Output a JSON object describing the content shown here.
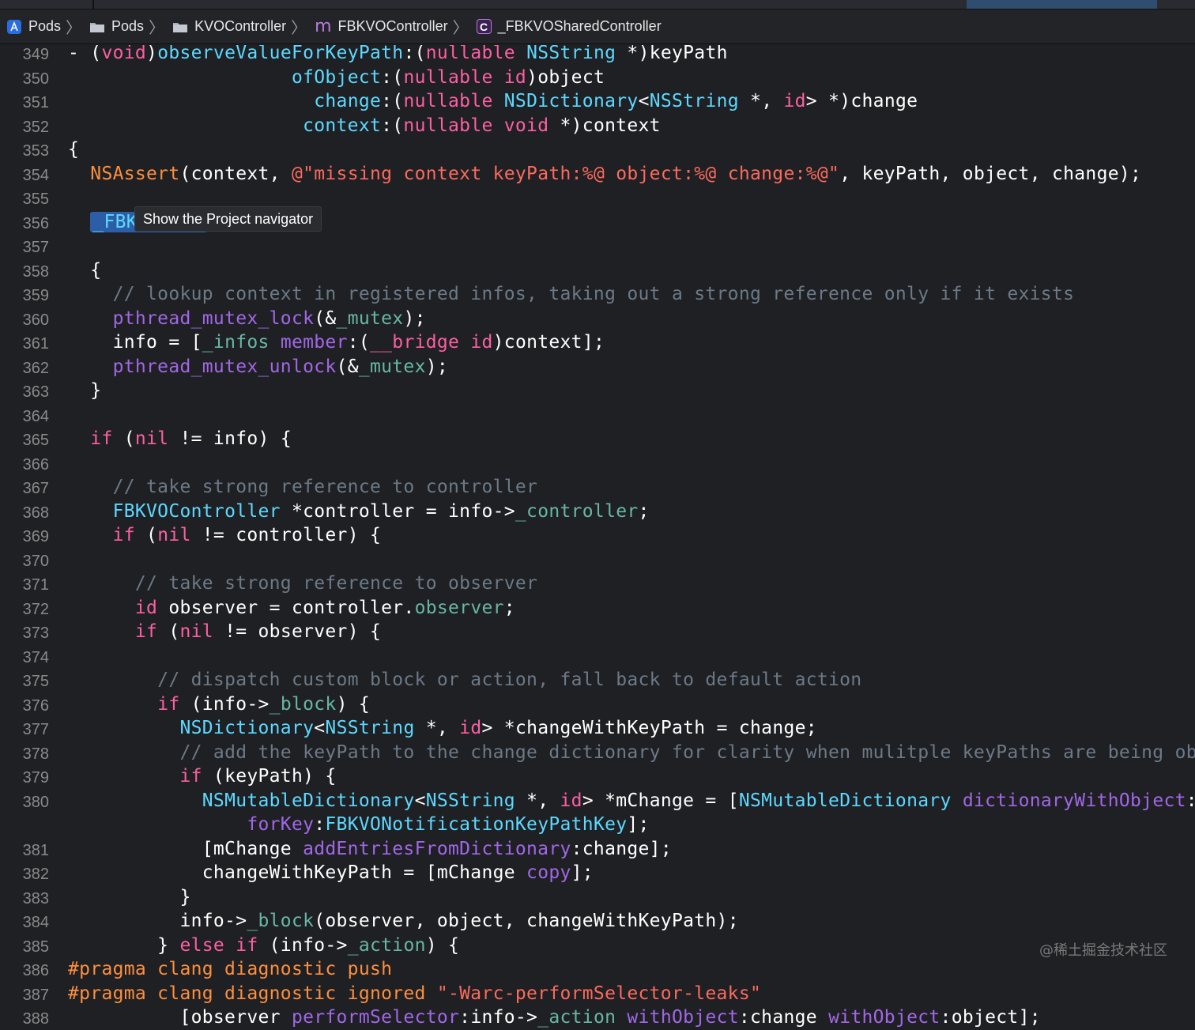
{
  "breadcrumbs": [
    {
      "label": "Pods",
      "icon": "xcode-project-icon"
    },
    {
      "label": "Pods",
      "icon": "folder-icon"
    },
    {
      "label": "KVOController",
      "icon": "folder-icon"
    },
    {
      "label": "FBKVOController",
      "icon": "m-file-icon"
    },
    {
      "label": "_FBKVOSharedController",
      "icon": "class-icon"
    }
  ],
  "tooltip": "Show the Project navigator",
  "watermark": "@稀土掘金技术社区",
  "colors": {
    "keyword": "#fc5fa3",
    "type": "#d0a8ff",
    "class": "#5dd8ff",
    "string": "#fc6a5d",
    "comment": "#6c7986",
    "preprocessor": "#fd8f3f",
    "selection": "#2c5ea8"
  },
  "lines": [
    {
      "n": "349",
      "s": [
        [
          "plain",
          "- ("
        ],
        [
          "kw",
          "void"
        ],
        [
          "plain",
          ")"
        ],
        [
          "cls",
          "observeValueForKeyPath"
        ],
        [
          "plain",
          ":("
        ],
        [
          "kw",
          "nullable"
        ],
        [
          "plain",
          " "
        ],
        [
          "cls",
          "NSString"
        ],
        [
          "plain",
          " *)keyPath"
        ]
      ]
    },
    {
      "n": "350",
      "s": [
        [
          "plain",
          "                    "
        ],
        [
          "cls",
          "ofObject"
        ],
        [
          "plain",
          ":("
        ],
        [
          "kw",
          "nullable"
        ],
        [
          "plain",
          " "
        ],
        [
          "kw",
          "id"
        ],
        [
          "plain",
          ")object"
        ]
      ]
    },
    {
      "n": "351",
      "s": [
        [
          "plain",
          "                      "
        ],
        [
          "cls",
          "change"
        ],
        [
          "plain",
          ":("
        ],
        [
          "kw",
          "nullable"
        ],
        [
          "plain",
          " "
        ],
        [
          "cls",
          "NSDictionary"
        ],
        [
          "plain",
          "<"
        ],
        [
          "cls",
          "NSString"
        ],
        [
          "plain",
          " *, "
        ],
        [
          "kw",
          "id"
        ],
        [
          "plain",
          "> *)change"
        ]
      ]
    },
    {
      "n": "352",
      "s": [
        [
          "plain",
          "                     "
        ],
        [
          "cls",
          "context"
        ],
        [
          "plain",
          ":("
        ],
        [
          "kw",
          "nullable"
        ],
        [
          "plain",
          " "
        ],
        [
          "kw",
          "void"
        ],
        [
          "plain",
          " *)context"
        ]
      ]
    },
    {
      "n": "353",
      "s": [
        [
          "plain",
          "{"
        ]
      ]
    },
    {
      "n": "354",
      "s": [
        [
          "plain",
          "  "
        ],
        [
          "mac",
          "NSAssert"
        ],
        [
          "plain",
          "(context, "
        ],
        [
          "str",
          "@\"missing context keyPath:%@ object:%@ change:%@\""
        ],
        [
          "plain",
          ", keyPath, object, change);"
        ]
      ]
    },
    {
      "n": "355",
      "s": []
    },
    {
      "n": "356",
      "s": [
        [
          "plain",
          "  "
        ],
        [
          "hl",
          "_FBKVOInfo"
        ],
        [
          "plain",
          " *info;"
        ]
      ]
    },
    {
      "n": "357",
      "s": []
    },
    {
      "n": "358",
      "s": [
        [
          "plain",
          "  {"
        ]
      ]
    },
    {
      "n": "359",
      "s": [
        [
          "plain",
          "    "
        ],
        [
          "cm",
          "// lookup context in registered infos, taking out a strong reference only if it exists"
        ]
      ]
    },
    {
      "n": "360",
      "s": [
        [
          "plain",
          "    "
        ],
        [
          "fn",
          "pthread_mutex_lock"
        ],
        [
          "plain",
          "(&"
        ],
        [
          "ivar",
          "_mutex"
        ],
        [
          "plain",
          ");"
        ]
      ]
    },
    {
      "n": "361",
      "s": [
        [
          "plain",
          "    info = ["
        ],
        [
          "ivar",
          "_infos"
        ],
        [
          "plain",
          " "
        ],
        [
          "fn",
          "member"
        ],
        [
          "plain",
          ":("
        ],
        [
          "kw",
          "__bridge"
        ],
        [
          "plain",
          " "
        ],
        [
          "kw",
          "id"
        ],
        [
          "plain",
          ")context];"
        ]
      ]
    },
    {
      "n": "362",
      "s": [
        [
          "plain",
          "    "
        ],
        [
          "fn",
          "pthread_mutex_unlock"
        ],
        [
          "plain",
          "(&"
        ],
        [
          "ivar",
          "_mutex"
        ],
        [
          "plain",
          ");"
        ]
      ]
    },
    {
      "n": "363",
      "s": [
        [
          "plain",
          "  }"
        ]
      ]
    },
    {
      "n": "364",
      "s": []
    },
    {
      "n": "365",
      "s": [
        [
          "plain",
          "  "
        ],
        [
          "kw",
          "if"
        ],
        [
          "plain",
          " ("
        ],
        [
          "kw",
          "nil"
        ],
        [
          "plain",
          " != info) {"
        ]
      ]
    },
    {
      "n": "366",
      "s": []
    },
    {
      "n": "367",
      "s": [
        [
          "plain",
          "    "
        ],
        [
          "cm",
          "// take strong reference to controller"
        ]
      ]
    },
    {
      "n": "368",
      "s": [
        [
          "plain",
          "    "
        ],
        [
          "cls",
          "FBKVOController"
        ],
        [
          "plain",
          " *controller = info->"
        ],
        [
          "ivar",
          "_controller"
        ],
        [
          "plain",
          ";"
        ]
      ]
    },
    {
      "n": "369",
      "s": [
        [
          "plain",
          "    "
        ],
        [
          "kw",
          "if"
        ],
        [
          "plain",
          " ("
        ],
        [
          "kw",
          "nil"
        ],
        [
          "plain",
          " != controller) {"
        ]
      ]
    },
    {
      "n": "370",
      "s": []
    },
    {
      "n": "371",
      "s": [
        [
          "plain",
          "      "
        ],
        [
          "cm",
          "// take strong reference to observer"
        ]
      ]
    },
    {
      "n": "372",
      "s": [
        [
          "plain",
          "      "
        ],
        [
          "kw",
          "id"
        ],
        [
          "plain",
          " observer = controller."
        ],
        [
          "prop",
          "observer"
        ],
        [
          "plain",
          ";"
        ]
      ]
    },
    {
      "n": "373",
      "s": [
        [
          "plain",
          "      "
        ],
        [
          "kw",
          "if"
        ],
        [
          "plain",
          " ("
        ],
        [
          "kw",
          "nil"
        ],
        [
          "plain",
          " != observer) {"
        ]
      ]
    },
    {
      "n": "374",
      "s": []
    },
    {
      "n": "375",
      "s": [
        [
          "plain",
          "        "
        ],
        [
          "cm",
          "// dispatch custom block or action, fall back to default action"
        ]
      ]
    },
    {
      "n": "376",
      "s": [
        [
          "plain",
          "        "
        ],
        [
          "kw",
          "if"
        ],
        [
          "plain",
          " (info->"
        ],
        [
          "ivar",
          "_block"
        ],
        [
          "plain",
          ") {"
        ]
      ]
    },
    {
      "n": "377",
      "s": [
        [
          "plain",
          "          "
        ],
        [
          "cls",
          "NSDictionary"
        ],
        [
          "plain",
          "<"
        ],
        [
          "cls",
          "NSString"
        ],
        [
          "plain",
          " *, "
        ],
        [
          "kw",
          "id"
        ],
        [
          "plain",
          "> *changeWithKeyPath = change;"
        ]
      ]
    },
    {
      "n": "378",
      "s": [
        [
          "plain",
          "          "
        ],
        [
          "cm",
          "// add the keyPath to the change dictionary for clarity when mulitple keyPaths are being obse"
        ]
      ]
    },
    {
      "n": "379",
      "s": [
        [
          "plain",
          "          "
        ],
        [
          "kw",
          "if"
        ],
        [
          "plain",
          " (keyPath) {"
        ]
      ]
    },
    {
      "n": "380",
      "s": [
        [
          "plain",
          "            "
        ],
        [
          "cls",
          "NSMutableDictionary"
        ],
        [
          "plain",
          "<"
        ],
        [
          "cls",
          "NSString"
        ],
        [
          "plain",
          " *, "
        ],
        [
          "kw",
          "id"
        ],
        [
          "plain",
          "> *mChange = ["
        ],
        [
          "cls",
          "NSMutableDictionary"
        ],
        [
          "plain",
          " "
        ],
        [
          "fn",
          "dictionaryWithObject"
        ],
        [
          "plain",
          ":ke"
        ]
      ]
    },
    {
      "n": "",
      "s": [
        [
          "plain",
          "                "
        ],
        [
          "fn",
          "forKey"
        ],
        [
          "plain",
          ":"
        ],
        [
          "cls",
          "FBKVONotificationKeyPathKey"
        ],
        [
          "plain",
          "];"
        ]
      ]
    },
    {
      "n": "381",
      "s": [
        [
          "plain",
          "            [mChange "
        ],
        [
          "fn",
          "addEntriesFromDictionary"
        ],
        [
          "plain",
          ":change];"
        ]
      ]
    },
    {
      "n": "382",
      "s": [
        [
          "plain",
          "            changeWithKeyPath = [mChange "
        ],
        [
          "fn",
          "copy"
        ],
        [
          "plain",
          "];"
        ]
      ]
    },
    {
      "n": "383",
      "s": [
        [
          "plain",
          "          }"
        ]
      ]
    },
    {
      "n": "384",
      "s": [
        [
          "plain",
          "          info->"
        ],
        [
          "ivar",
          "_block"
        ],
        [
          "plain",
          "(observer, object, changeWithKeyPath);"
        ]
      ]
    },
    {
      "n": "385",
      "s": [
        [
          "plain",
          "        } "
        ],
        [
          "kw",
          "else if"
        ],
        [
          "plain",
          " (info->"
        ],
        [
          "ivar",
          "_action"
        ],
        [
          "plain",
          ") {"
        ]
      ]
    },
    {
      "n": "386",
      "s": [
        [
          "pp",
          "#pragma clang diagnostic push"
        ]
      ]
    },
    {
      "n": "387",
      "s": [
        [
          "pp",
          "#pragma clang diagnostic ignored "
        ],
        [
          "str",
          "\"-Warc-performSelector-leaks\""
        ]
      ]
    },
    {
      "n": "388",
      "s": [
        [
          "plain",
          "          [observer "
        ],
        [
          "fn",
          "performSelector"
        ],
        [
          "plain",
          ":info->"
        ],
        [
          "ivar",
          "_action"
        ],
        [
          "plain",
          " "
        ],
        [
          "fn",
          "withObject"
        ],
        [
          "plain",
          ":change "
        ],
        [
          "fn",
          "withObject"
        ],
        [
          "plain",
          ":object];"
        ]
      ]
    }
  ]
}
